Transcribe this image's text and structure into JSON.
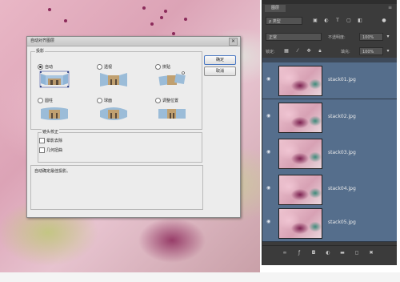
{
  "dialog": {
    "title": "自动对齐图层",
    "close_label": "✕",
    "projection_label": "投影",
    "options": [
      {
        "label": "自动",
        "selected": true
      },
      {
        "label": "透视",
        "selected": false
      },
      {
        "label": "拼贴",
        "selected": false
      },
      {
        "label": "圆柱",
        "selected": false
      },
      {
        "label": "球面",
        "selected": false
      },
      {
        "label": "调整位置",
        "selected": false
      }
    ],
    "lens_label": "镜头校正",
    "checks": [
      {
        "label": "晕影去除",
        "checked": false
      },
      {
        "label": "几何扭曲",
        "checked": false
      }
    ],
    "ok_label": "确定",
    "cancel_label": "取消",
    "description": "自动确定最佳投影。"
  },
  "panel": {
    "tab": "图层",
    "menu_icon": "≡",
    "filter_label": "ρ 类型",
    "blend_mode": "正常",
    "opacity_label": "不透明度:",
    "opacity_value": "100%",
    "lock_label": "锁定:",
    "fill_label": "填充:",
    "fill_value": "100%",
    "layers": [
      "stack01.jpg",
      "stack02.jpg",
      "stack03.jpg",
      "stack04.jpg",
      "stack05.jpg"
    ],
    "colors": {
      "selected_row": "#556e8c",
      "panel_bg": "#3b3b3b"
    }
  }
}
